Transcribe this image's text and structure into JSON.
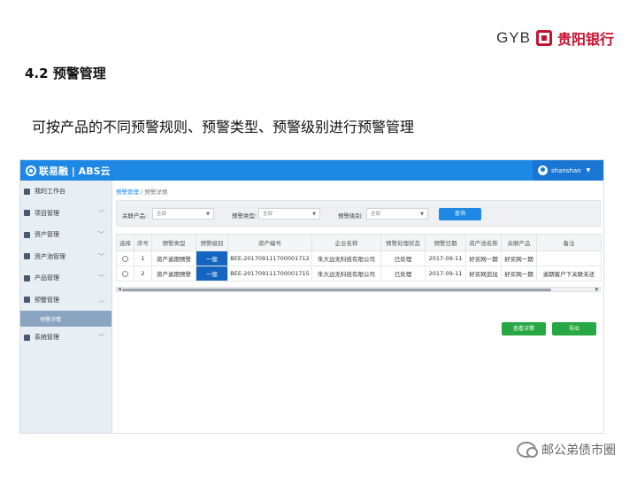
{
  "header": {
    "brand_text": "GYB",
    "brand_cn": "贵阳银行"
  },
  "section_title": "4.2 预警管理",
  "subtitle": "可按产品的不同预警规则、预警类型、预警级别进行预警管理",
  "app": {
    "logo": "联易融 | ABS云",
    "user": "shanshan",
    "sidebar": [
      {
        "label": "我的工作台",
        "chevron": ""
      },
      {
        "label": "项目管理",
        "chevron": "﹀"
      },
      {
        "label": "资产管理",
        "chevron": "﹀"
      },
      {
        "label": "资产池管理",
        "chevron": "﹀"
      },
      {
        "label": "产品管理",
        "chevron": "﹀"
      },
      {
        "label": "预警管理",
        "chevron": "︿"
      }
    ],
    "sidebar_sub": "预警详情",
    "sidebar_last": {
      "label": "系统管理",
      "chevron": "﹀"
    },
    "breadcrumb": {
      "first": "预警管理",
      "sep": "/",
      "second": "预警详情"
    },
    "filters": {
      "product_label": "关联产品:",
      "product_value": "全部",
      "type_label": "预警类型:",
      "type_value": "全部",
      "level_label": "预警级别:",
      "level_value": "全部",
      "search_button": "查询"
    },
    "table": {
      "headers": [
        "选择",
        "序号",
        "预警类型",
        "预警级别",
        "资产编号",
        "企业名称",
        "预警处理状态",
        "预警日期",
        "资产池名称",
        "关联产品",
        "备注"
      ],
      "rows": [
        [
          "",
          "1",
          "资产逾期预警",
          "一般",
          "BEE-201709111700001712",
          "朱大边无科技有限公司",
          "已处理",
          "2017-09-11",
          "好买网一期",
          "好买网一期",
          ""
        ],
        [
          "",
          "2",
          "资产逾期预警",
          "一般",
          "BEE-201709111700001715",
          "朱大边无科技有限公司",
          "已处理",
          "2017-09-11",
          "好买网追加",
          "好买网一期",
          "逾期客户下关联未还"
        ]
      ]
    },
    "buttons": {
      "detail": "查看详情",
      "export": "导出"
    }
  },
  "watermark": "邮公弟债市圈"
}
